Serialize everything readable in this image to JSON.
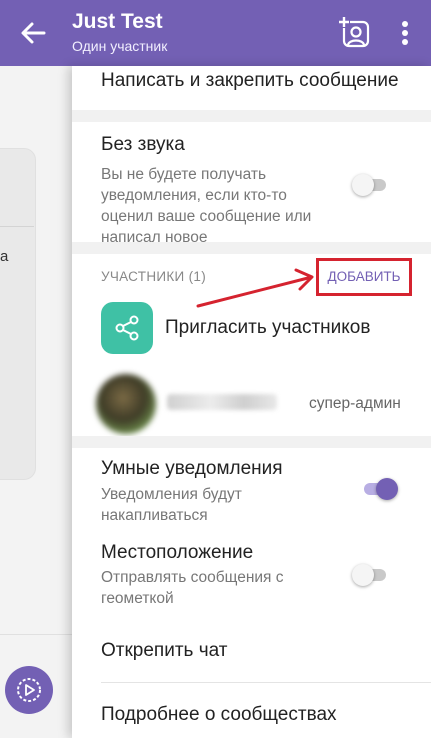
{
  "header": {
    "title": "Just Test",
    "subtitle": "Один участник",
    "back_icon": "arrow-left-icon",
    "add_contact_icon": "add-contact-icon",
    "more_icon": "more-vertical-icon"
  },
  "chat": {
    "partial_text": "a",
    "compose_icon": "compose-icon"
  },
  "drawer": {
    "write_and_pin": "Написать и закрепить сообщение",
    "mute": {
      "title": "Без звука",
      "description": "Вы не будете получать уведомления, если кто-то оценил ваше сообщение или написал новое",
      "enabled": false
    },
    "participants": {
      "header": "УЧАСТНИКИ (1)",
      "add_label": "ДОБАВИТЬ",
      "invite_label": "Пригласить участников",
      "invite_icon": "share-icon",
      "member_role": "супер-админ"
    },
    "smart_notifications": {
      "title": "Умные уведомления",
      "description": "Уведомления будут накапливаться",
      "enabled": true
    },
    "location": {
      "title": "Местоположение",
      "description": "Отправлять сообщения с геометкой",
      "enabled": false
    },
    "unpin_chat": "Открепить чат",
    "about_communities": "Подробнее о сообществах"
  },
  "colors": {
    "brand": "#7360b4",
    "invite": "#3fc1a5",
    "highlight": "#d5232f"
  }
}
